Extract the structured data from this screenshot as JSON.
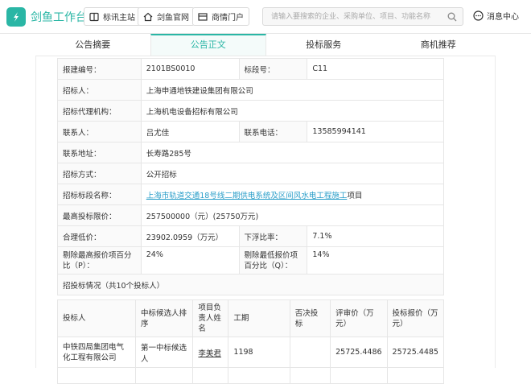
{
  "app": {
    "logo_text": "剑鱼工作台",
    "brand_color": "#2ab6a5"
  },
  "topnav": [
    {
      "label": "标讯主站",
      "icon": "book-icon"
    },
    {
      "label": "剑鱼官网",
      "icon": "home-icon"
    },
    {
      "label": "商情门户",
      "icon": "portal-icon"
    }
  ],
  "search": {
    "placeholder": "请输入要搜索的企业、采购单位、项目、功能名称"
  },
  "messages": {
    "label": "消息中心"
  },
  "tabs": [
    {
      "label": "公告摘要",
      "active": false
    },
    {
      "label": "公告正文",
      "active": true
    },
    {
      "label": "投标服务",
      "active": false
    },
    {
      "label": "商机推荐",
      "active": false
    }
  ],
  "info": {
    "project_no_label": "报建编号：",
    "project_no": "2101BS0010",
    "section_no_label": "标段号：",
    "section_no": "C11",
    "tenderer_label": "招标人：",
    "tenderer": "上海申通地铁建设集团有限公司",
    "agency_label": "招标代理机构：",
    "agency": "上海机电设备招标有限公司",
    "contact_label": "联系人：",
    "contact": "吕尤佳",
    "phone_label": "联系电话：",
    "phone": "13585994141",
    "address_label": "联系地址：",
    "address": "长寿路285号",
    "method_label": "招标方式：",
    "method": "公开招标",
    "section_name_label": "招标标段名称：",
    "section_name_link": "上海市轨道交通18号线二期供电系统及区间风水电工程施工",
    "section_name_suffix": "项目",
    "max_price_label": "最高投标限价：",
    "max_price": "257500000（元）(25750万元)",
    "low_price_label": "合理低价：",
    "low_price": "23902.0959（万元）",
    "float_label": "下浮比率：",
    "float_rate": "7.1%",
    "rm_high_label": "剔除最高报价项百分比（P）：",
    "rm_high": "24%",
    "rm_low_label": "剔除最低报价项百分比（Q）：",
    "rm_low": "14%",
    "bids_summary": "招投标情况（共10个投标人）"
  },
  "bid_table": {
    "headers": [
      "投标人",
      "中标候选人排序",
      "项目负责人姓名",
      "工期",
      "否决投标",
      "评审价（万元）",
      "投标报价（万元）"
    ],
    "rows": [
      {
        "bidder": "中铁四局集团电气化工程有限公司",
        "rank": "第一中标候选人",
        "manager": "李美君",
        "duration": "1198",
        "rejected": "",
        "review_price": "25725.4486",
        "bid_price": "25725.4485"
      }
    ]
  }
}
